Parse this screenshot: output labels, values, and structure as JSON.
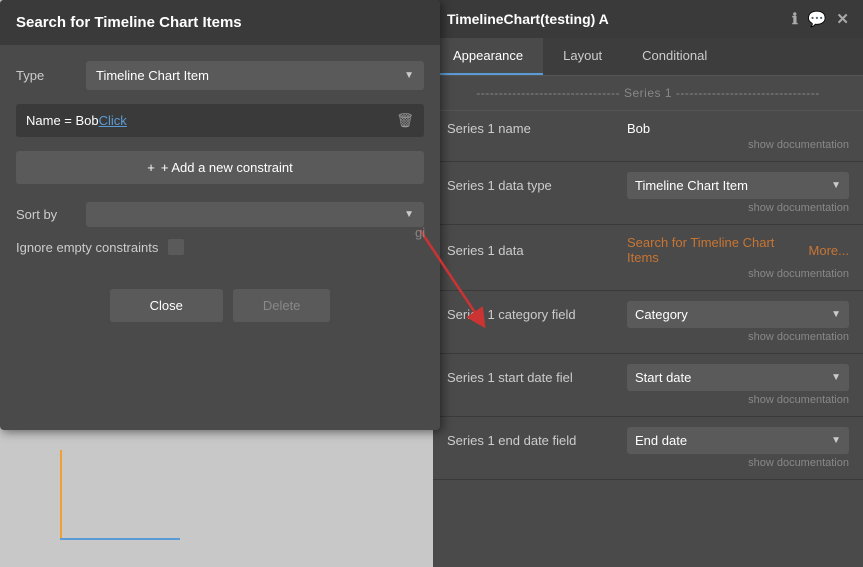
{
  "searchPanel": {
    "title": "Search for Timeline Chart Items",
    "typeLabel": "Type",
    "typeValue": "Timeline Chart Item",
    "constraintText": "Name = Bob",
    "constraintLink": "Click",
    "addConstraintLabel": "+ Add a new constraint",
    "sortLabel": "Sort by",
    "ignoreLabel": "Ignore empty constraints",
    "closeLabel": "Close",
    "deleteLabel": "Delete"
  },
  "rightPanel": {
    "title": "TimelineChart(testing) A",
    "tabs": [
      {
        "label": "Appearance",
        "active": true
      },
      {
        "label": "Layout",
        "active": false
      },
      {
        "label": "Conditional",
        "active": false
      }
    ],
    "seriesHeader": "Series 1",
    "properties": [
      {
        "label": "Series 1 name",
        "type": "text",
        "value": "Bob",
        "showDoc": true
      },
      {
        "label": "Series 1 data type",
        "type": "dropdown",
        "value": "Timeline Chart Item",
        "showDoc": true
      },
      {
        "label": "Series 1 data",
        "type": "link",
        "value": "Search for Timeline Chart Items",
        "extra": "More...",
        "showDoc": true
      },
      {
        "label": "Series 1 category field",
        "type": "dropdown",
        "value": "Category",
        "showDoc": true
      },
      {
        "label": "Series 1 start date fiel",
        "type": "dropdown",
        "value": "Start date",
        "showDoc": true
      },
      {
        "label": "Series 1 end date field",
        "type": "dropdown",
        "value": "End date",
        "showDoc": true
      }
    ]
  },
  "icons": {
    "info": "ℹ",
    "comment": "💬",
    "close": "✕",
    "dropdown": "▼",
    "trash": "🗑",
    "plus": "+"
  }
}
